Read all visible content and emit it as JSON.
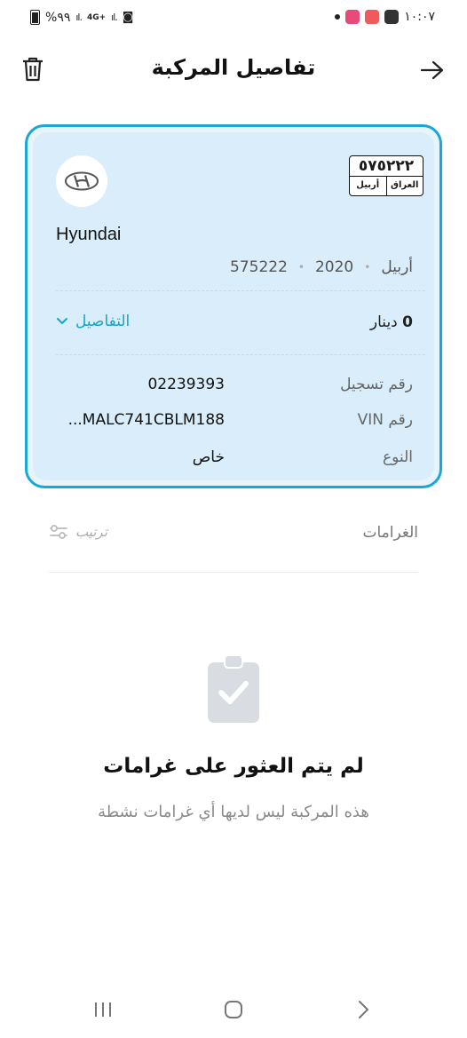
{
  "status_bar": {
    "battery_text": "%٩٩",
    "network": "4G+",
    "time": "١٠:٠٧"
  },
  "header": {
    "title": "تفاصيل المركبة"
  },
  "vehicle": {
    "brand": "Hyundai",
    "plate": {
      "number": "٥٧٥٢٢٢",
      "country": "العراق",
      "city": "أربيل"
    },
    "city": "أربيل",
    "year": "2020",
    "plate_number": "575222",
    "fee_amount": "0",
    "fee_currency": "دينار",
    "details_label": "التفاصيل",
    "fields": [
      {
        "label": "رقم تسجيل",
        "value": "02239393"
      },
      {
        "label": "رقم VIN",
        "value": "...MALC741CBLM188"
      },
      {
        "label": "النوع",
        "value": "خاص"
      }
    ]
  },
  "fines": {
    "title": "الغرامات",
    "sort_label": "ترتيب",
    "empty_title": "لم يتم العثور على غرامات",
    "empty_subtitle": "هذه المركبة ليس لديها أي غرامات نشطة"
  },
  "colors": {
    "accent": "#17a3c9",
    "card_border": "#1ba6d6",
    "card_bg": "#d9eefa"
  }
}
